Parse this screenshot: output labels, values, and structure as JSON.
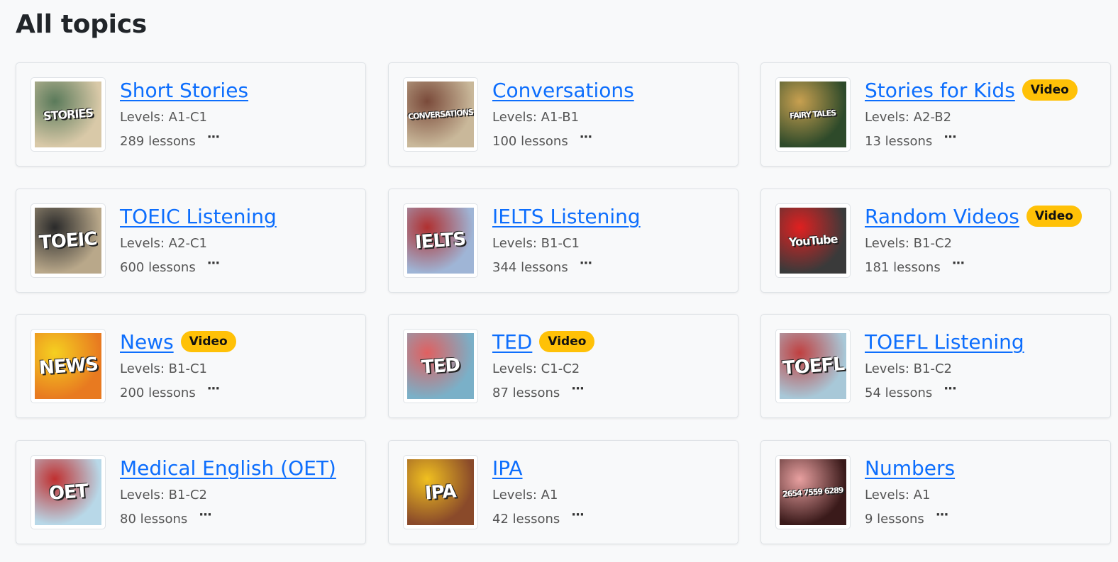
{
  "page": {
    "title": "All topics"
  },
  "topics": [
    {
      "title": "Short Stories",
      "badge": "",
      "levels": "Levels: A1-C1",
      "lessons": "289 lessons",
      "more": "···",
      "thumb": {
        "text": "STORIES",
        "bg": "#d9c9a8",
        "accent": "#5a7a5a"
      }
    },
    {
      "title": "Conversations",
      "badge": "",
      "levels": "Levels: A1-B1",
      "lessons": "100 lessons",
      "more": "···",
      "thumb": {
        "text": "CONVERSATIONS",
        "bg": "#c9b89a",
        "accent": "#7a4a3a"
      }
    },
    {
      "title": "Stories for Kids",
      "badge": "Video",
      "levels": "Levels: A2-B2",
      "lessons": "13 lessons",
      "more": "···",
      "thumb": {
        "text": "FAIRY TALES",
        "bg": "#2e4a2a",
        "accent": "#c8a050"
      }
    },
    {
      "title": "TOEIC Listening",
      "badge": "",
      "levels": "Levels: A2-C1",
      "lessons": "600 lessons",
      "more": "···",
      "thumb": {
        "text": "TOEIC",
        "bg": "#b9a88a",
        "accent": "#2a2a2a"
      }
    },
    {
      "title": "IELTS Listening",
      "badge": "",
      "levels": "Levels: B1-C1",
      "lessons": "344 lessons",
      "more": "···",
      "thumb": {
        "text": "IELTS",
        "bg": "#9fb5d6",
        "accent": "#b03030"
      }
    },
    {
      "title": "Random Videos",
      "badge": "Video",
      "levels": "Levels: B1-C2",
      "lessons": "181 lessons",
      "more": "···",
      "thumb": {
        "text": "YouTube",
        "bg": "#3a3a3a",
        "accent": "#e02020"
      }
    },
    {
      "title": "News",
      "badge": "Video",
      "levels": "Levels: B1-C1",
      "lessons": "200 lessons",
      "more": "···",
      "thumb": {
        "text": "NEWS",
        "bg": "#e87a20",
        "accent": "#f5d020"
      }
    },
    {
      "title": "TED",
      "badge": "Video",
      "levels": "Levels: C1-C2",
      "lessons": "87 lessons",
      "more": "···",
      "thumb": {
        "text": "TED",
        "bg": "#7ab0c8",
        "accent": "#e06060"
      }
    },
    {
      "title": "TOEFL Listening",
      "badge": "",
      "levels": "Levels: B1-C2",
      "lessons": "54 lessons",
      "more": "···",
      "thumb": {
        "text": "TOEFL",
        "bg": "#a8c8d8",
        "accent": "#c04040"
      }
    },
    {
      "title": "Medical English (OET)",
      "badge": "",
      "levels": "Levels: B1-C2",
      "lessons": "80 lessons",
      "more": "···",
      "thumb": {
        "text": "OET",
        "bg": "#b8d8e8",
        "accent": "#c03030"
      }
    },
    {
      "title": "IPA",
      "badge": "",
      "levels": "Levels: A1",
      "lessons": "42 lessons",
      "more": "···",
      "thumb": {
        "text": "IPA",
        "bg": "#8a4a2a",
        "accent": "#f0c020"
      }
    },
    {
      "title": "Numbers",
      "badge": "",
      "levels": "Levels: A1",
      "lessons": "9 lessons",
      "more": "···",
      "thumb": {
        "text": "2654 7559 6289",
        "bg": "#3a1a1a",
        "accent": "#e8a0a0"
      }
    }
  ]
}
